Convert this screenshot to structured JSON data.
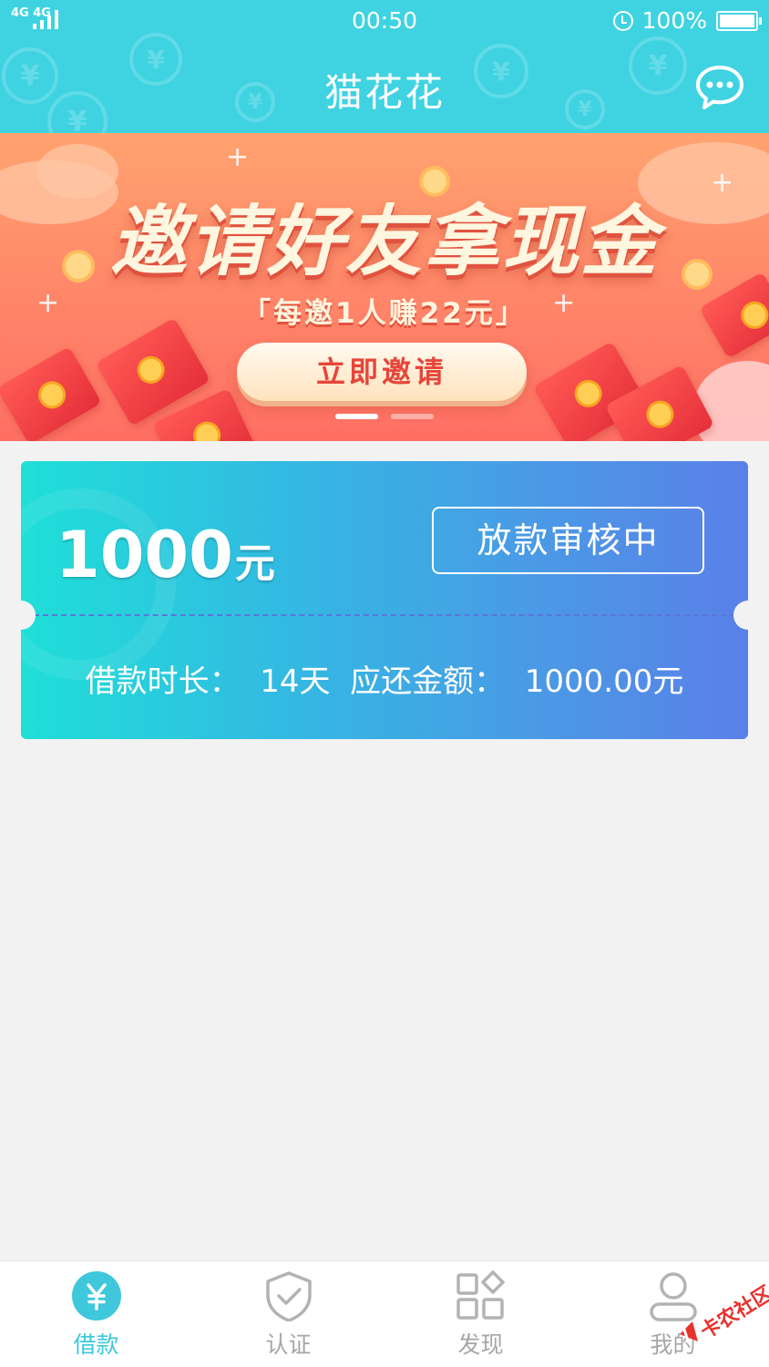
{
  "status_bar": {
    "network": "4G 4G",
    "time": "00:50",
    "battery": "100%"
  },
  "header": {
    "title": "猫花花",
    "chat_icon": "chat-bubble-icon"
  },
  "banner": {
    "headline": "邀请好友拿现金",
    "subtitle": "「每邀1人赚22元」",
    "button_label": "立即邀请",
    "slide_count": 2,
    "active_slide": 1
  },
  "loan_card": {
    "amount": "1000",
    "amount_unit": "元",
    "status": "放款审核中",
    "details": "借款时长：  14天  应还金额：  1000.00元"
  },
  "bottom_nav": {
    "items": [
      {
        "label": "借款",
        "icon": "yuan-coin-icon",
        "active": true
      },
      {
        "label": "认证",
        "icon": "shield-check-icon",
        "active": false
      },
      {
        "label": "发现",
        "icon": "grid-diamond-icon",
        "active": false
      },
      {
        "label": "我的",
        "icon": "user-icon",
        "active": false
      }
    ]
  },
  "watermark": {
    "text": "卡农社区"
  },
  "colors": {
    "header_bg": "#3fd3e2",
    "active_tab": "#3fc7db",
    "inactive_tab": "#a6a6a6",
    "invite_text": "#e8453a"
  }
}
